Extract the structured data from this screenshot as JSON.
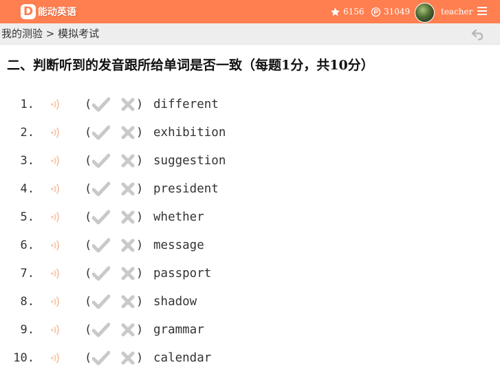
{
  "header": {
    "logo_letter": "D",
    "logo_text": "能动英语",
    "stars": "6156",
    "coins": "31049",
    "username": "teacher",
    "accent_color": "#ff7f50"
  },
  "breadcrumb": {
    "path": "我的测验 > 模拟考试"
  },
  "section": {
    "title": "二、判断听到的发音跟所给单词是否一致（每题1分，共10分）"
  },
  "items": [
    {
      "num": "1.",
      "word": "different"
    },
    {
      "num": "2.",
      "word": "exhibition"
    },
    {
      "num": "3.",
      "word": "suggestion"
    },
    {
      "num": "4.",
      "word": "president"
    },
    {
      "num": "5.",
      "word": "whether"
    },
    {
      "num": "6.",
      "word": "message"
    },
    {
      "num": "7.",
      "word": "passport"
    },
    {
      "num": "8.",
      "word": "shadow"
    },
    {
      "num": "9.",
      "word": "grammar"
    },
    {
      "num": "10.",
      "word": "calendar"
    }
  ],
  "icons": {
    "audio": "speaker-icon",
    "true": "check-icon",
    "false": "cross-icon",
    "back": "undo-icon",
    "menu": "hamburger-icon"
  }
}
